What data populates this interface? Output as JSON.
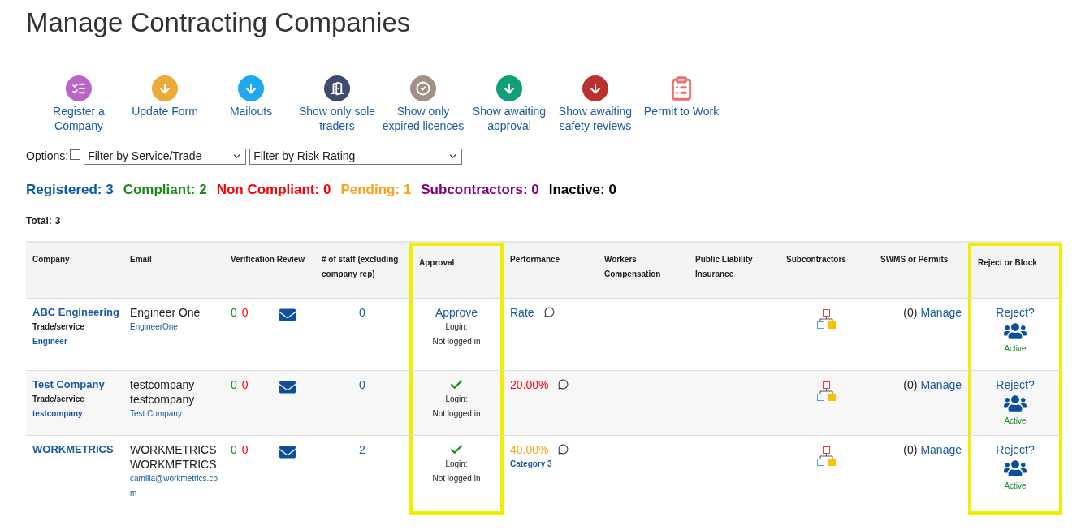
{
  "page_title": "Manage Contracting Companies",
  "toolbar": [
    {
      "label": "Register a Company",
      "kind": "list",
      "color": "#b966c8"
    },
    {
      "label": "Update Form",
      "kind": "down",
      "color": "#eeaa38"
    },
    {
      "label": "Mailouts",
      "kind": "down",
      "color": "#1ea9ef"
    },
    {
      "label": "Show only sole traders",
      "kind": "door",
      "color": "#3e4a6e"
    },
    {
      "label": "Show only expired licences",
      "kind": "check",
      "color": "#a39187"
    },
    {
      "label": "Show awaiting approval",
      "kind": "down",
      "color": "#119f77"
    },
    {
      "label": "Show awaiting safety reviews",
      "kind": "down",
      "color": "#b8312f"
    },
    {
      "label": "Permit to Work",
      "kind": "clipboard",
      "color": "#ec6f6b"
    }
  ],
  "options": {
    "label": "Options:",
    "checked": false,
    "filters": [
      "Filter by Service/Trade",
      "Filter by Risk Rating"
    ]
  },
  "counts": [
    {
      "text": "Registered: 3",
      "color": "#0b5aa5"
    },
    {
      "text": "Compliant: 2",
      "color": "#1d8a1d"
    },
    {
      "text": "Non Compliant: 0",
      "color": "#ff0000"
    },
    {
      "text": "Pending: 1",
      "color": "#ffa21a"
    },
    {
      "text": "Subcontractors: 0",
      "color": "#800080"
    },
    {
      "text": "Inactive: 0",
      "color": "#000000"
    }
  ],
  "total": {
    "label": "Total:",
    "value": "3"
  },
  "table": {
    "columns": [
      {
        "label": "Company",
        "highlighted": false
      },
      {
        "label": "Email",
        "highlighted": false
      },
      {
        "label": "Verification Review",
        "highlighted": false
      },
      {
        "label": "# of staff (excluding company rep)",
        "highlighted": false
      },
      {
        "label": "Approval",
        "highlighted": true
      },
      {
        "label": "Performance",
        "highlighted": false
      },
      {
        "label": "Workers Compensation",
        "highlighted": false
      },
      {
        "label": "Public Liability Insurance",
        "highlighted": false
      },
      {
        "label": "Subcontractors",
        "highlighted": false
      },
      {
        "label": "SWMS or Permits",
        "highlighted": false
      },
      {
        "label": "Reject or Block",
        "highlighted": true
      }
    ],
    "rows": [
      {
        "company": "ABC Engineering",
        "trade_label": "Trade/service",
        "trade": "Engineer",
        "contact": "Engineer One",
        "email": "EngineerOne",
        "verified": "0",
        "unverified": "0",
        "staff": "0",
        "approved": false,
        "approve_text": "Approve",
        "login_label": "Login:",
        "login_status": "Not logged in",
        "performance": {
          "text": "Rate",
          "kind": "link"
        },
        "swms_count": "(0)",
        "swms_link": "Manage",
        "reject": "Reject?",
        "status": "Active"
      },
      {
        "company": "Test Company",
        "trade_label": "Trade/service",
        "trade": "testcompany",
        "contact": "testcompany testcompany",
        "email": "Test Company",
        "verified": "0",
        "unverified": "0",
        "staff": "0",
        "approved": true,
        "login_label": "Login:",
        "login_status": "Not logged in",
        "performance": {
          "text": "20.00%",
          "kind": "bad"
        },
        "swms_count": "(0)",
        "swms_link": "Manage",
        "reject": "Reject?",
        "status": "Active"
      },
      {
        "company": "WORKMETRICS",
        "contact": "WORKMETRICS WORKMETRICS",
        "email": "camilla@workmetrics.com",
        "verified": "0",
        "unverified": "0",
        "staff": "2",
        "approved": true,
        "login_label": "Login:",
        "login_status": "Not logged in",
        "performance": {
          "text": "40.00%",
          "kind": "warn",
          "category": "Category 3"
        },
        "swms_count": "(0)",
        "swms_link": "Manage",
        "reject": "Reject?",
        "status": "Active"
      }
    ]
  }
}
